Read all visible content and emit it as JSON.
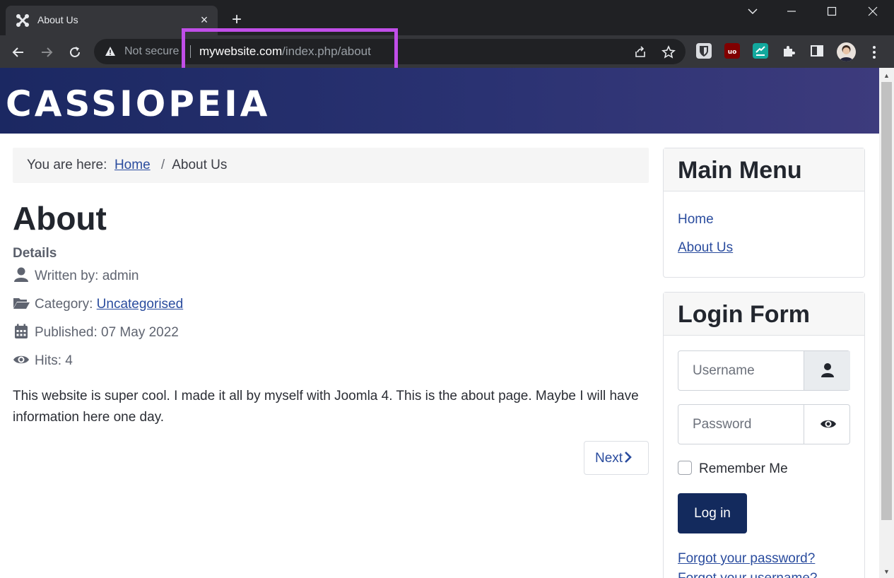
{
  "browser": {
    "tab_title": "About Us",
    "new_tab_glyph": "+",
    "tab_close_glyph": "×",
    "security_label": "Not secure",
    "url_host": "mywebsite.com",
    "url_path": "/index.php/about",
    "icons": [
      "joomla-favicon",
      "back-arrow-icon",
      "forward-arrow-icon",
      "reload-icon",
      "warning-icon",
      "share-icon",
      "bookmark-star-icon",
      "bitwarden-extension-icon",
      "ublock-extension-icon",
      "extension-icon",
      "extensions-puzzle-icon",
      "side-panel-icon",
      "profile-avatar",
      "menu-icon"
    ],
    "highlight_color": "#c04ee8"
  },
  "site": {
    "brand": "CASSIOPEIA",
    "header_gradient": [
      "#1b2862",
      "#3d3b7d"
    ]
  },
  "breadcrumb": {
    "prefix": "You are here:",
    "items": [
      "Home",
      "About Us"
    ],
    "separator": "/"
  },
  "article": {
    "title": "About",
    "details_label": "Details",
    "author": "Written by: admin",
    "category_label": "Category: ",
    "category_link": "Uncategorised",
    "published": "Published: 07 May 2022",
    "hits": "Hits: 4",
    "body": "This website is super cool. I made it all by myself with Joomla 4. This is the about page. Maybe I will have information here one day.",
    "next_label": "Next"
  },
  "main_menu": {
    "title": "Main Menu",
    "items": [
      "Home",
      "About Us"
    ]
  },
  "login": {
    "title": "Login Form",
    "username_placeholder": "Username",
    "password_placeholder": "Password",
    "remember_label": "Remember Me",
    "login_button": "Log in",
    "forgot_password": "Forgot your password?",
    "forgot_username": "Forgot your username?",
    "button_color": "#132a5d"
  },
  "colors": {
    "link": "#2a4c9e",
    "text": "#22262e"
  }
}
